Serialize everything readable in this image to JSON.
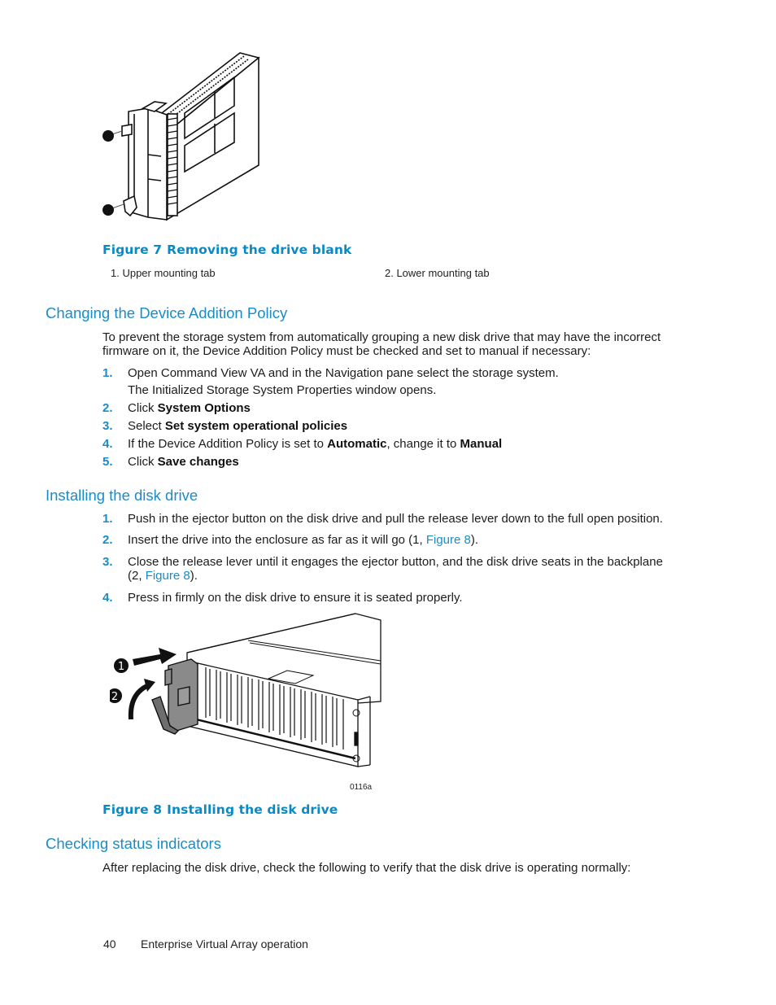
{
  "figure7": {
    "image_label": "drive-blank-illustration",
    "caption_number": "Figure 7",
    "caption_title": "Removing the drive blank",
    "legend": [
      {
        "label": "1.  Upper mounting tab"
      },
      {
        "label": "2.  Lower mounting tab"
      }
    ]
  },
  "section_device_policy": {
    "heading": "Changing the Device Addition Policy",
    "intro_line1": "To prevent the storage system from automatically grouping a new disk drive that may have the incorrect",
    "intro_line2": "firmware on it, the Device Addition Policy must be checked and set to manual if necessary:",
    "steps": [
      {
        "num": "1.",
        "pre": "Open Command View VA and in the Navigation pane select the storage system.",
        "bold": "",
        "mid": "",
        "bold2": "",
        "note": "The Initialized Storage System Properties window opens."
      },
      {
        "num": "2.",
        "pre": "Click ",
        "bold": "System Options"
      },
      {
        "num": "3.",
        "pre": "Select ",
        "bold": "Set system operational policies"
      },
      {
        "num": "4.",
        "pre": "If the Device Addition Policy is set to ",
        "bold": "Automatic",
        "mid": ", change it to ",
        "bold2": "Manual"
      },
      {
        "num": "5.",
        "pre": "Click ",
        "bold": "Save changes"
      }
    ]
  },
  "section_install": {
    "heading": "Installing the disk drive",
    "steps": [
      {
        "num": "1.",
        "text": "Push in the ejector button on the disk drive and pull the release lever down to the full open position."
      },
      {
        "num": "2.",
        "pre": "Insert the drive into the enclosure as far as it will go (1, ",
        "link": "Figure 8",
        "post": ")."
      },
      {
        "num": "3.",
        "line1": "Close the release lever until it engages the ejector button, and the disk drive seats in the backplane",
        "pre2": "(2, ",
        "link": "Figure 8",
        "post2": ")."
      },
      {
        "num": "4.",
        "text": "Press in firmly on the disk drive to ensure it is seated properly."
      }
    ]
  },
  "figure8": {
    "callouts": [
      "1",
      "2"
    ],
    "image_code": "0116a",
    "caption_number": "Figure 8",
    "caption_title": "Installing the disk drive"
  },
  "section_status": {
    "heading": "Checking status indicators",
    "intro": "After replacing the disk drive, check the following to verify that the disk drive is operating normally:"
  },
  "footer": {
    "page_number": "40",
    "chapter_title": "Enterprise Virtual Array operation"
  }
}
